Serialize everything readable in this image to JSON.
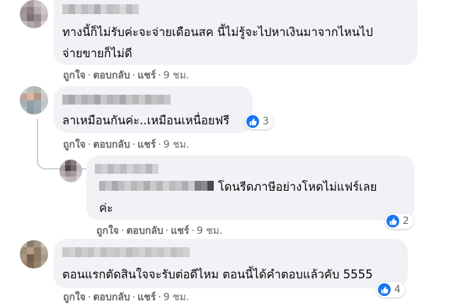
{
  "colors": {
    "bubble": "#f0f2f5",
    "action_text": "#65676b",
    "like_blue": "#1877f2"
  },
  "comments": [
    {
      "text_lines": [
        "ทางนี้ก็ไม่รับค่ะจะจ่ายเดือนสค นี้ไม่รู้จะไปหาเงินมาจากไหนไป",
        "จ่ายขายก็ไม่ดี"
      ],
      "actions": {
        "like": "ถูกใจ",
        "reply": "ตอบกลับ",
        "share": "แชร์",
        "time": "9 ชม."
      }
    },
    {
      "text_lines": [
        "ลาเหมือนกันค่ะ..เหมือนเหนื่อยฟรี"
      ],
      "reactions": {
        "icon": "like-icon",
        "count": "3"
      },
      "actions": {
        "like": "ถูกใจ",
        "reply": "ตอบกลับ",
        "share": "แชร์",
        "time": "9 ชม."
      }
    },
    {
      "text_lines": [
        "โดนรีดภาษีอย่างโหดไม่แฟร์เลย",
        "ค่ะ"
      ],
      "reactions": {
        "icon": "like-icon",
        "count": "2"
      },
      "actions": {
        "like": "ถูกใจ",
        "reply": "ตอบกลับ",
        "share": "แชร์",
        "time": "9 ชม."
      }
    },
    {
      "text_lines": [
        "ตอนแรกตัดสินใจจะรับต่อดีไหม ตอนนี้ได้คำตอบแล้วคับ 5555"
      ],
      "reactions": {
        "icon": "like-icon",
        "count": "4"
      },
      "actions": {
        "like": "ถูกใจ",
        "reply": "ตอบกลับ",
        "share": "แชร์",
        "time": "9 ชม."
      }
    }
  ]
}
